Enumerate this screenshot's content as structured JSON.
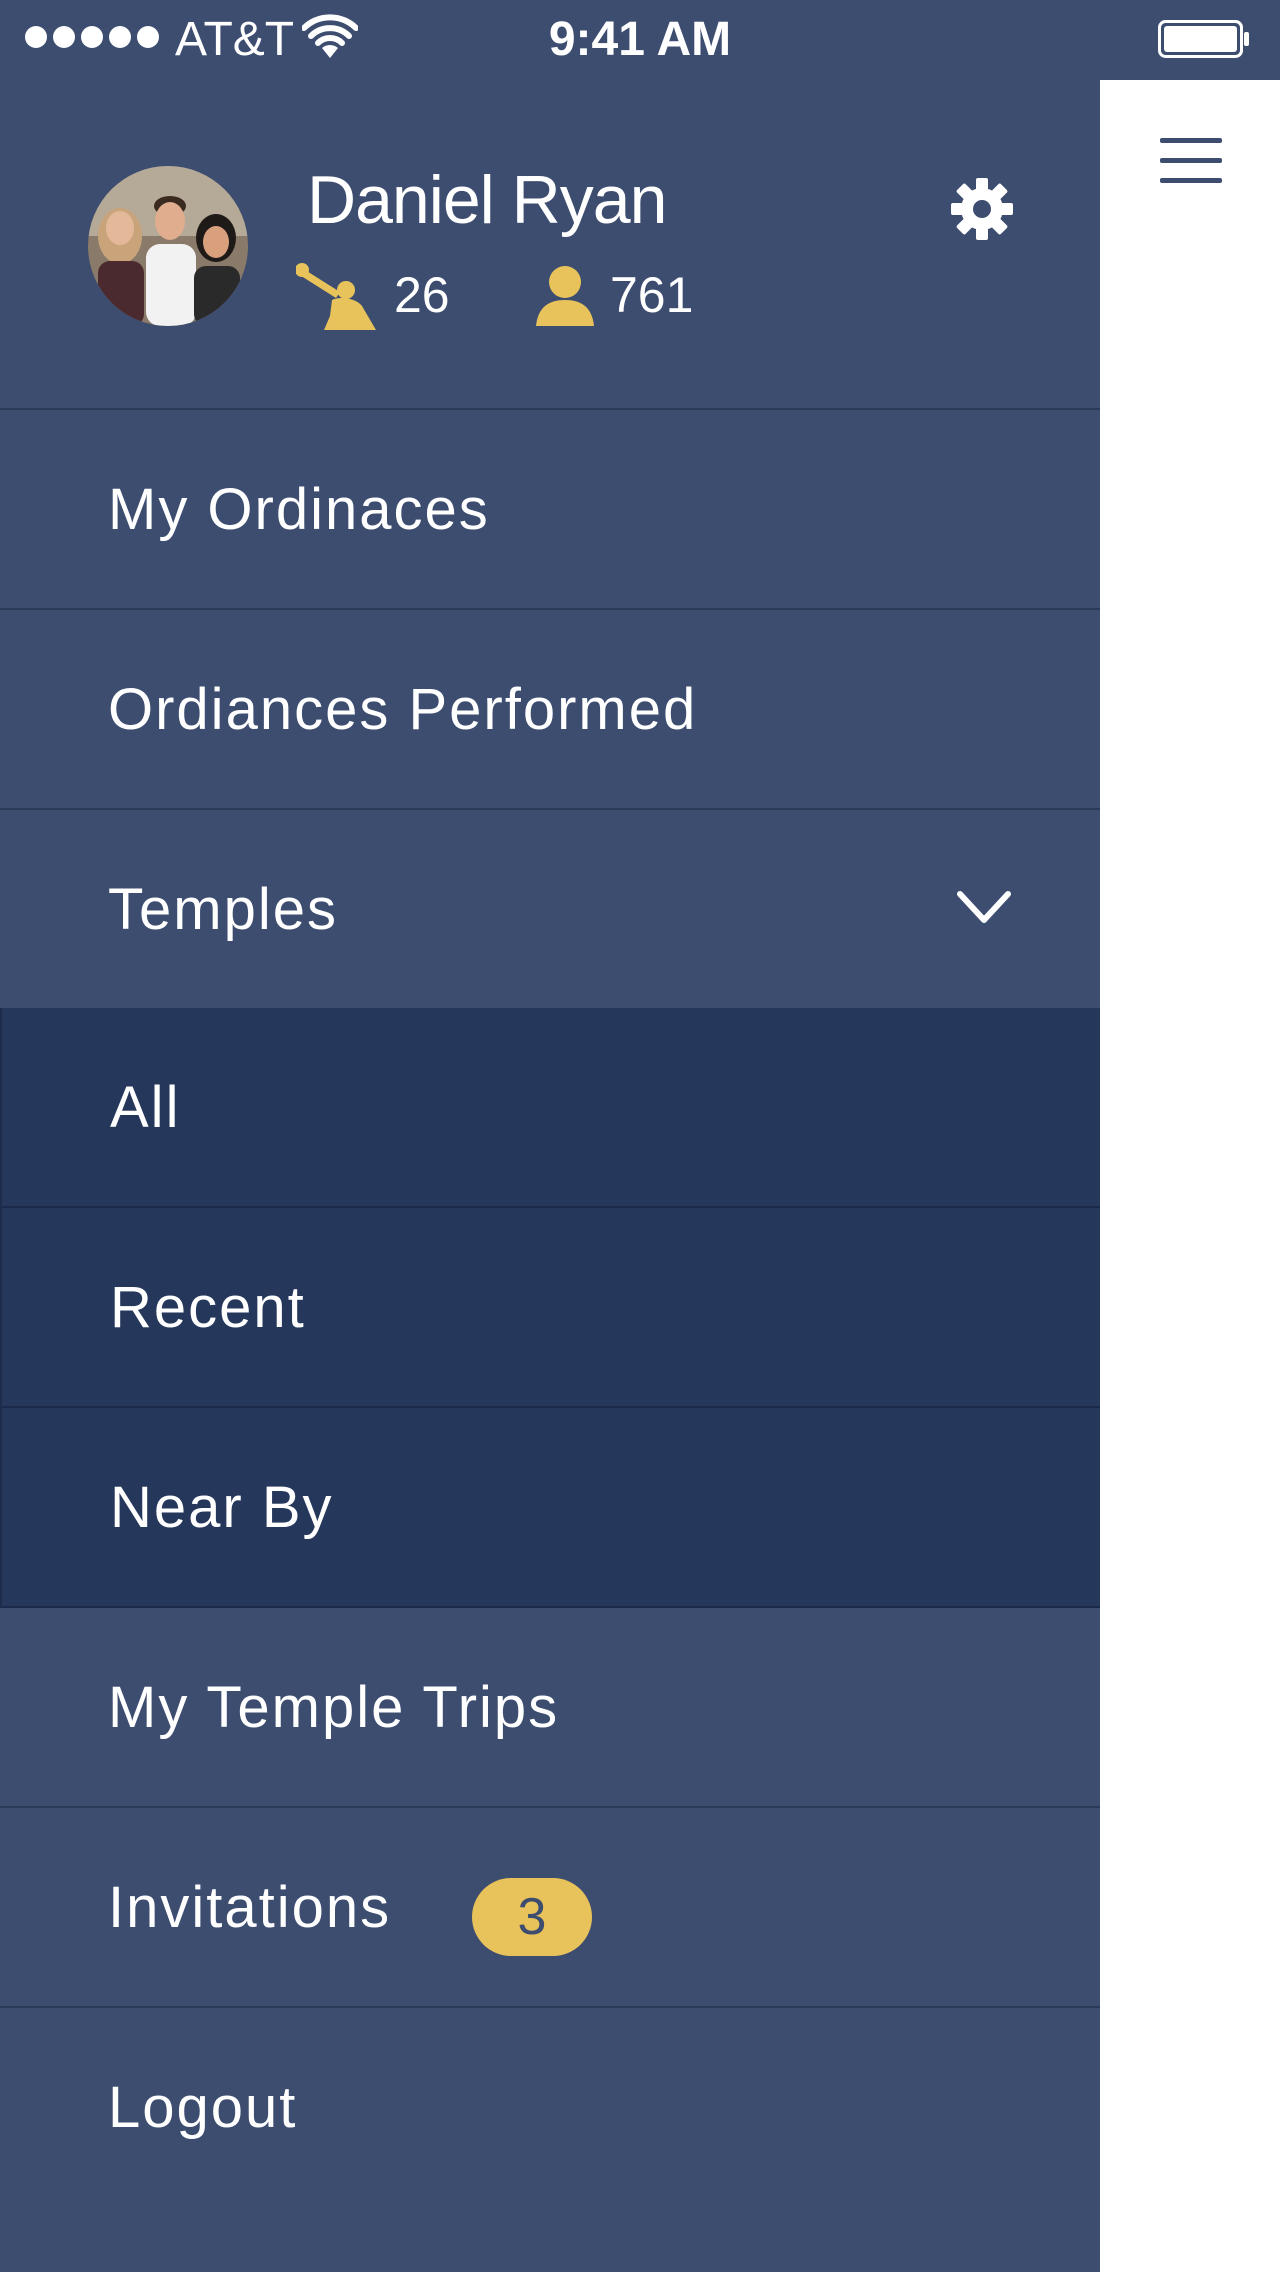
{
  "status_bar": {
    "carrier": "AT&T",
    "time": "9:41 AM",
    "signal_bars": 5,
    "icons": [
      "signal-dots-icon",
      "wifi-icon",
      "battery-icon"
    ]
  },
  "profile": {
    "name": "Daniel Ryan",
    "stats": [
      {
        "icon": "angel-moroni-icon",
        "value": "26"
      },
      {
        "icon": "person-icon",
        "value": "761"
      }
    ],
    "settings_icon": "gear-icon"
  },
  "menu": {
    "items": [
      {
        "label": "My Ordinaces"
      },
      {
        "label": "Ordiances Performed"
      },
      {
        "label": "Temples",
        "expanded": true,
        "icon": "chevron-down-icon"
      },
      {
        "label": "All",
        "submenu": true
      },
      {
        "label": "Recent",
        "submenu": true
      },
      {
        "label": "Near By",
        "submenu": true
      },
      {
        "label": "My Temple Trips"
      },
      {
        "label": "Invitations",
        "badge": "3"
      },
      {
        "label": "Logout"
      }
    ]
  },
  "content": {
    "menu_icon": "hamburger-icon"
  },
  "colors": {
    "drawer_bg": "#3d4d70",
    "submenu_bg": "#26375c",
    "accent_gold": "#e8c25a",
    "text": "#ffffff",
    "content_bg": "#ffffff"
  }
}
